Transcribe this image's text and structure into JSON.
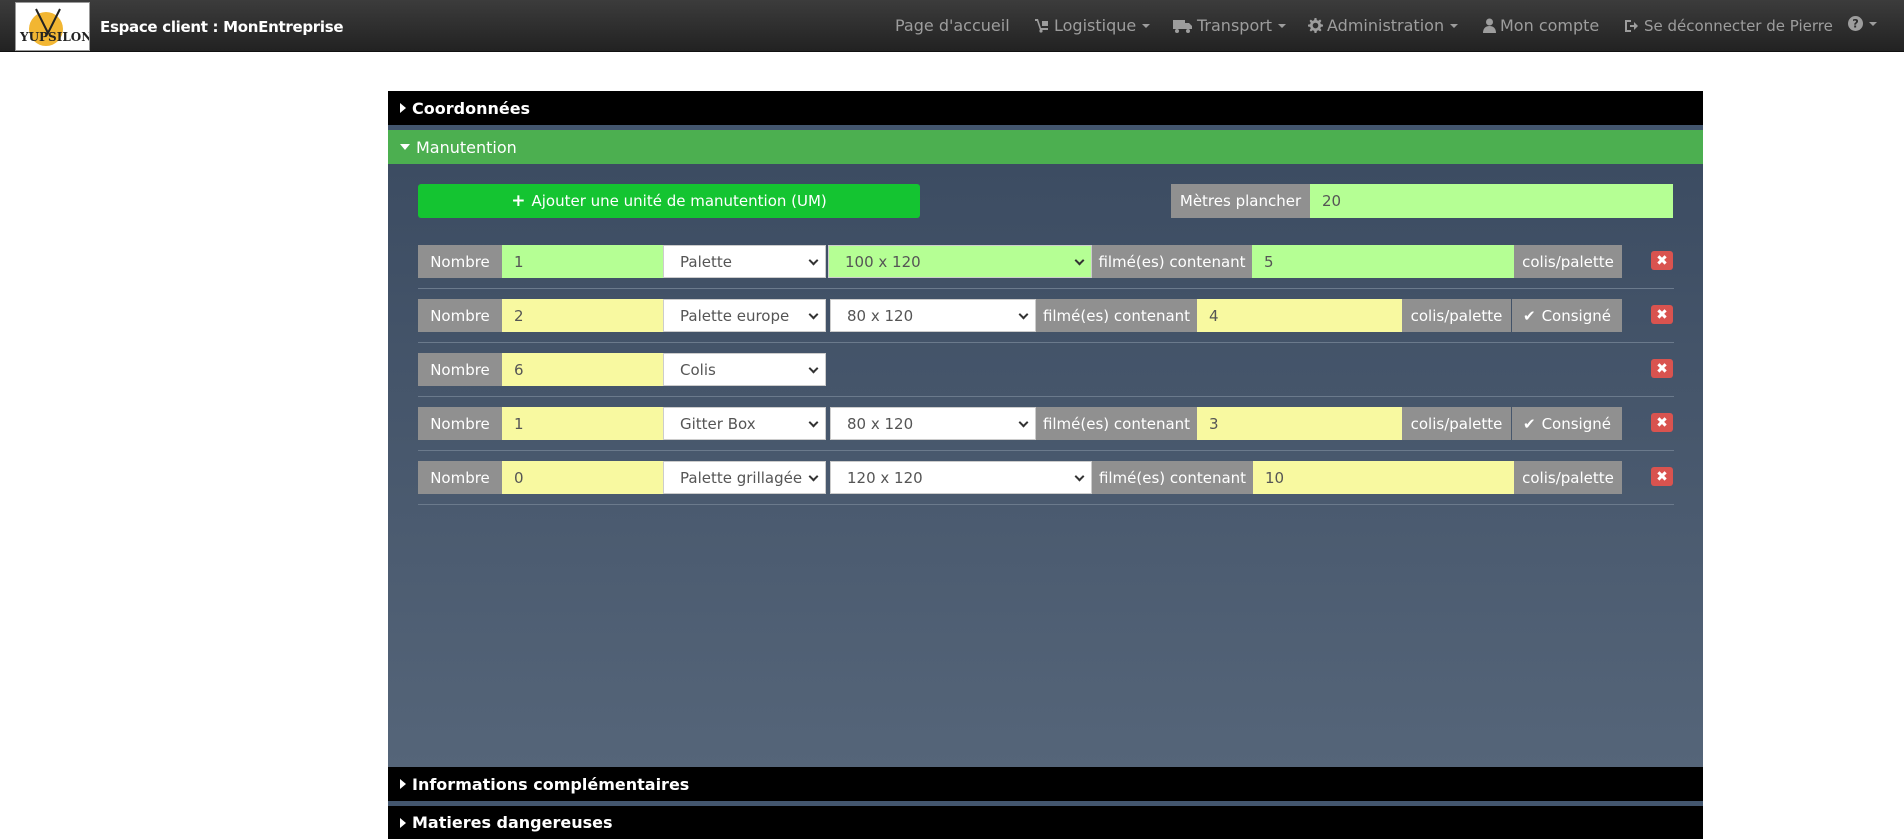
{
  "navbar": {
    "logo_text": "YUPSILON",
    "brand": "Espace client : MonEntreprise",
    "items": [
      {
        "label": "Page d'accueil"
      },
      {
        "label": "Logistique"
      },
      {
        "label": "Transport"
      },
      {
        "label": "Administration"
      },
      {
        "label": "Mon compte"
      },
      {
        "label": "Se déconnecter de Pierre"
      }
    ]
  },
  "sections": {
    "coordonnees": "Coordonnées",
    "manutention": "Manutention",
    "infos": "Informations complémentaires",
    "matieres": "Matieres dangereuses"
  },
  "manutention": {
    "add_label": "Ajouter une unité de manutention (UM)",
    "metres_label": "Mètres plancher",
    "metres_value": "20",
    "rows": [
      {
        "nombre_label": "Nombre",
        "nombre": "1",
        "type": "Palette",
        "size": "100 x 120",
        "filme_label": "filmé(es) contenant",
        "colis": "5",
        "unit_label": "colis/palette",
        "consigne": ""
      },
      {
        "nombre_label": "Nombre",
        "nombre": "2",
        "type": "Palette europe",
        "size": "80 x 120",
        "filme_label": "filmé(es) contenant",
        "colis": "4",
        "unit_label": "colis/palette",
        "consigne": "Consigné"
      },
      {
        "nombre_label": "Nombre",
        "nombre": "6",
        "type": "Colis",
        "size": "",
        "filme_label": "",
        "colis": "",
        "unit_label": "",
        "consigne": ""
      },
      {
        "nombre_label": "Nombre",
        "nombre": "1",
        "type": "Gitter Box",
        "size": "80 x 120",
        "filme_label": "filmé(es) contenant",
        "colis": "3",
        "unit_label": "colis/palette",
        "consigne": "Consigné"
      },
      {
        "nombre_label": "Nombre",
        "nombre": "0",
        "type": "Palette grillagée",
        "size": "120 x 120",
        "filme_label": "filmé(es) contenant",
        "colis": "10",
        "unit_label": "colis/palette",
        "consigne": ""
      }
    ]
  },
  "colors": {
    "green_head": "#4caf50",
    "add_button": "#14c431",
    "valid_field": "#b5ff94",
    "pending_field": "#f8f9a0",
    "delete": "#d9534f"
  }
}
